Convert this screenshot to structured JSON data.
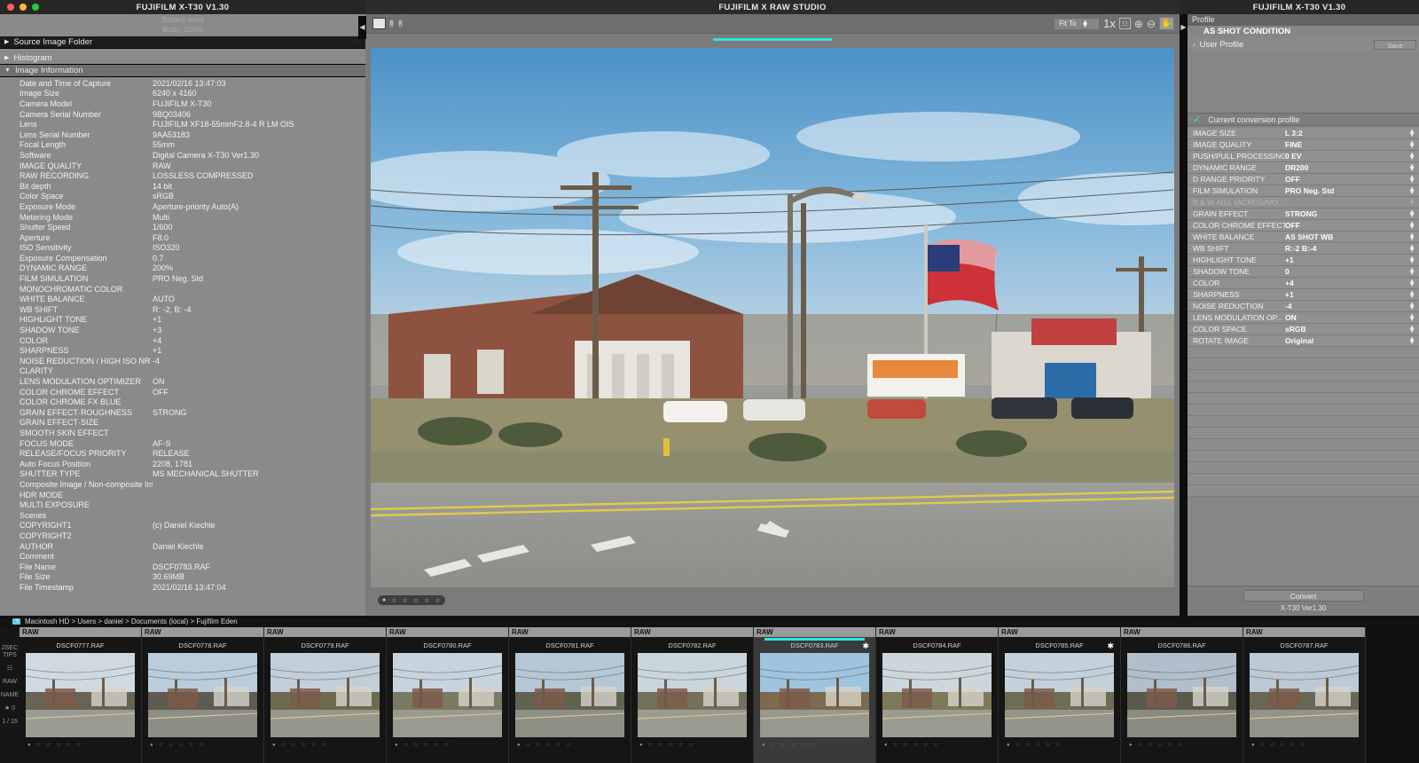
{
  "window": {
    "left_title": "FUJIFILM X-T30   V1.30",
    "center_title": "FUJIFILM X RAW STUDIO",
    "right_title": "FUJIFILM X-T30   V1.30"
  },
  "left_panel": {
    "battery_label": "Battery level",
    "battery_value": "Body: 100%",
    "sections": [
      {
        "label": "Source Image Folder",
        "expanded": false
      },
      {
        "label": "Histogram",
        "expanded": false
      },
      {
        "label": "Image Information",
        "expanded": true
      }
    ],
    "image_information": [
      {
        "key": "Date and Time of Capture",
        "value": "2021/02/16 13:47:03"
      },
      {
        "key": "Image Size",
        "value": "6240 x 4160"
      },
      {
        "key": "Camera Model",
        "value": "FUJIFILM X-T30"
      },
      {
        "key": "Camera Serial Number",
        "value": "9BQ03406"
      },
      {
        "key": "Lens",
        "value": "FUJIFILM XF18-55mmF2.8-4 R LM OIS"
      },
      {
        "key": "Lens Serial Number",
        "value": "9AA53183"
      },
      {
        "key": "Focal Length",
        "value": "55mm"
      },
      {
        "key": "Software",
        "value": "Digital Camera X-T30 Ver1.30"
      },
      {
        "key": "IMAGE QUALITY",
        "value": "RAW"
      },
      {
        "key": "RAW RECORDING",
        "value": "LOSSLESS COMPRESSED"
      },
      {
        "key": "Bit depth",
        "value": "14 bit"
      },
      {
        "key": "Color Space",
        "value": "sRGB"
      },
      {
        "key": "Exposure Mode",
        "value": "Aperture-priority Auto(A)"
      },
      {
        "key": "Metering Mode",
        "value": "Multi"
      },
      {
        "key": "Shutter Speed",
        "value": "1/600"
      },
      {
        "key": "Aperture",
        "value": "F8.0"
      },
      {
        "key": "ISO Sensitivity",
        "value": "ISO320"
      },
      {
        "key": "Exposure Compensation",
        "value": "0.7"
      },
      {
        "key": "DYNAMIC RANGE",
        "value": "200%"
      },
      {
        "key": "FILM SIMULATION",
        "value": "PRO Neg. Std"
      },
      {
        "key": "MONOCHROMATIC COLOR",
        "value": ""
      },
      {
        "key": "WHITE BALANCE",
        "value": "AUTO"
      },
      {
        "key": "WB SHIFT",
        "value": "R: -2, B: -4"
      },
      {
        "key": "HIGHLIGHT TONE",
        "value": "+1"
      },
      {
        "key": "SHADOW TONE",
        "value": "+3"
      },
      {
        "key": "COLOR",
        "value": "+4"
      },
      {
        "key": "SHARPNESS",
        "value": "+1"
      },
      {
        "key": "NOISE REDUCTION / HIGH ISO NR",
        "value": "-4"
      },
      {
        "key": "CLARITY",
        "value": ""
      },
      {
        "key": "LENS MODULATION OPTIMIZER",
        "value": "ON"
      },
      {
        "key": "COLOR CHROME EFFECT",
        "value": "OFF"
      },
      {
        "key": "COLOR CHROME FX BLUE",
        "value": ""
      },
      {
        "key": "GRAIN EFFECT·ROUGHNESS",
        "value": "STRONG"
      },
      {
        "key": "GRAIN EFFECT·SIZE",
        "value": ""
      },
      {
        "key": "SMOOTH SKIN EFFECT",
        "value": ""
      },
      {
        "key": "FOCUS MODE",
        "value": "AF-S"
      },
      {
        "key": "RELEASE/FOCUS PRIORITY",
        "value": "RELEASE"
      },
      {
        "key": "Auto Focus Position",
        "value": "2208, 1781"
      },
      {
        "key": "SHUTTER TYPE",
        "value": "MS MECHANICAL SHUTTER"
      },
      {
        "key": "Composite Image / Non-composite Image",
        "value": ""
      },
      {
        "key": "HDR MODE",
        "value": ""
      },
      {
        "key": "MULTI EXPOSURE",
        "value": ""
      },
      {
        "key": "Scenes",
        "value": ""
      },
      {
        "key": "COPYRIGHT1",
        "value": "(c) Daniel Kiechle"
      },
      {
        "key": "COPYRIGHT2",
        "value": ""
      },
      {
        "key": "AUTHOR",
        "value": "Daniel Kiechle"
      },
      {
        "key": "Comment",
        "value": ""
      },
      {
        "key": "File Name",
        "value": "DSCF0783.RAF"
      },
      {
        "key": "File Size",
        "value": "30.69MB"
      },
      {
        "key": "File Timestamp",
        "value": "2021/02/16 13:47:04"
      }
    ]
  },
  "toolbar": {
    "ba_a": "A",
    "ba_b": "B",
    "fit_to_label": "Fit To",
    "one_x_label": "1x",
    "icons": [
      "fit-screen-icon",
      "zoom-in-icon",
      "zoom-out-icon",
      "hand-tool-icon"
    ]
  },
  "preview": {
    "rating_stars": 5,
    "rating_value": 0
  },
  "right_panel": {
    "profile_header": "Profile",
    "as_shot_condition": "AS SHOT CONDITION",
    "user_profile": "User Profile",
    "save_label": "Save",
    "current_conversion_profile": "Current conversion profile",
    "settings": [
      {
        "key": "IMAGE SIZE",
        "value": "L 3:2",
        "enabled": true
      },
      {
        "key": "IMAGE QUALITY",
        "value": "FINE",
        "enabled": true
      },
      {
        "key": "PUSH/PULL PROCESSING",
        "value": "0 EV",
        "enabled": true
      },
      {
        "key": "DYNAMIC RANGE",
        "value": "DR200",
        "enabled": true
      },
      {
        "key": "D RANGE PRIORITY",
        "value": "OFF",
        "enabled": true
      },
      {
        "key": "FILM SIMULATION",
        "value": "PRO Neg. Std",
        "enabled": true
      },
      {
        "key": "B & W ADJ. (ACROS/MO...",
        "value": "",
        "enabled": false
      },
      {
        "key": "GRAIN EFFECT",
        "value": "STRONG",
        "enabled": true
      },
      {
        "key": "COLOR CHROME EFFECT",
        "value": "OFF",
        "enabled": true
      },
      {
        "key": "WHITE BALANCE",
        "value": "AS SHOT WB",
        "enabled": true
      },
      {
        "key": "WB SHIFT",
        "value": "R:-2 B:-4",
        "enabled": true
      },
      {
        "key": "HIGHLIGHT TONE",
        "value": "+1",
        "enabled": true
      },
      {
        "key": "SHADOW TONE",
        "value": "0",
        "enabled": true
      },
      {
        "key": "COLOR",
        "value": "+4",
        "enabled": true
      },
      {
        "key": "SHARPNESS",
        "value": "+1",
        "enabled": true
      },
      {
        "key": "NOISE REDUCTION",
        "value": "-4",
        "enabled": true
      },
      {
        "key": "LENS MODULATION OP...",
        "value": "ON",
        "enabled": true
      },
      {
        "key": "COLOR SPACE",
        "value": "sRGB",
        "enabled": true
      },
      {
        "key": "ROTATE IMAGE",
        "value": "Original",
        "enabled": true
      }
    ],
    "convert_label": "Convert",
    "convert_version": "X-T30 Ver1.30"
  },
  "filmstrip": {
    "breadcrumb": "Macintosh HD > Users > daniel > Documents (local) > Fujifilm Eden",
    "rail_labels": [
      "2SEC TIPS",
      "☷",
      "RAW",
      "NAME",
      "★ 0",
      "1 / 15"
    ],
    "raw_badge": "RAW",
    "thumbnails": [
      {
        "name": "DSCF0777.RAF",
        "selected": false,
        "starred": false
      },
      {
        "name": "DSCF0778.RAF",
        "selected": false,
        "starred": false
      },
      {
        "name": "DSCF0779.RAF",
        "selected": false,
        "starred": false
      },
      {
        "name": "DSCF0780.RAF",
        "selected": false,
        "starred": false
      },
      {
        "name": "DSCF0781.RAF",
        "selected": false,
        "starred": false
      },
      {
        "name": "DSCF0782.RAF",
        "selected": false,
        "starred": false
      },
      {
        "name": "DSCF0783.RAF",
        "selected": true,
        "starred": true
      },
      {
        "name": "DSCF0784.RAF",
        "selected": false,
        "starred": false
      },
      {
        "name": "DSCF0785.RAF",
        "selected": false,
        "starred": true
      },
      {
        "name": "DSCF0786.RAF",
        "selected": false,
        "starred": false
      },
      {
        "name": "DSCF0787.RAF",
        "selected": false,
        "starred": false
      }
    ]
  },
  "colors": {
    "accent_cyan": "#2ee6e0",
    "panel_grey": "#8a8a8a",
    "dark_chrome": "#1c1c1c"
  }
}
